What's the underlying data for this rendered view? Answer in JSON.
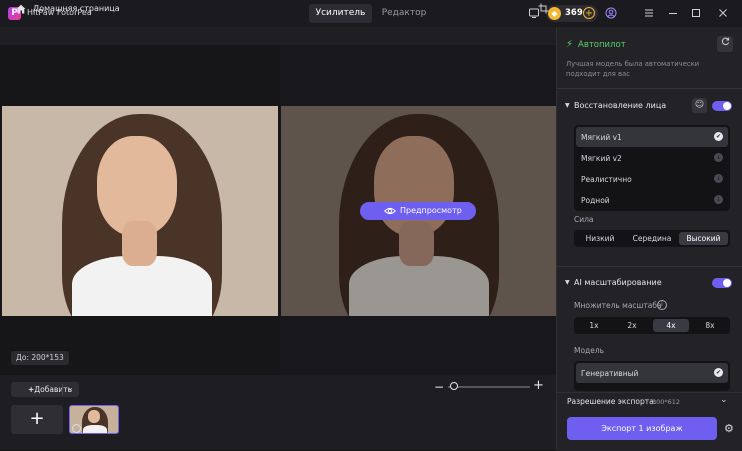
{
  "app": {
    "logo_letter": "P",
    "title": "HitPaw FotorPea"
  },
  "tabs": [
    {
      "label": "Усилитель",
      "active": true
    },
    {
      "label": "Редактор",
      "active": false
    }
  ],
  "titlebar": {
    "credits": "369",
    "icons": [
      "monitor-icon",
      "coin-icon",
      "add-credits-icon",
      "user-icon",
      "menu-icon",
      "minimize-icon",
      "maximize-icon",
      "close-icon"
    ]
  },
  "breadcrumb": {
    "home_label": "Домашняя страница"
  },
  "canvas": {
    "preview_label": "Предпросмотр",
    "size_label": "До: 200*153"
  },
  "bottom": {
    "add_label": "Добавить",
    "add_tile": "+"
  },
  "panel": {
    "autopilot": {
      "label": "Автопилот",
      "description": "Лучшая модель была автоматически подходит для вас"
    },
    "face_restore": {
      "title": "Восстановление лица",
      "enabled": true,
      "options": [
        {
          "label": "Мягкий v1",
          "selected": true
        },
        {
          "label": "Мягкий v2",
          "selected": false
        },
        {
          "label": "Реалистично",
          "selected": false
        },
        {
          "label": "Родной",
          "selected": false
        }
      ],
      "strength_label": "Сила",
      "strength_options": [
        {
          "label": "Низкий",
          "active": false
        },
        {
          "label": "Середина",
          "active": false
        },
        {
          "label": "Высокий",
          "active": true
        }
      ]
    },
    "ai_upscale": {
      "title": "AI масштабирование",
      "enabled": true,
      "scale_label": "Множитель масштаба",
      "scale_options": [
        {
          "label": "1x",
          "active": false
        },
        {
          "label": "2x",
          "active": false
        },
        {
          "label": "4x",
          "active": true
        },
        {
          "label": "8x",
          "active": false
        }
      ],
      "model_label": "Модель",
      "model_selected": "Генеративный"
    },
    "export": {
      "resolution_label": "Разрешение экспорта:",
      "resolution_value": "800*612",
      "button_label": "Экспорт 1 изображ"
    }
  },
  "colors": {
    "accent": "#6e5ff0",
    "autopilot_green": "#5cd16a",
    "credit_gold": "#f4b731"
  }
}
